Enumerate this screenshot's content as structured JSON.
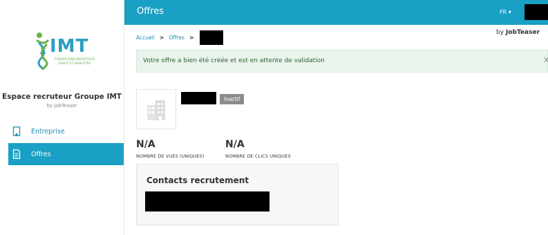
{
  "sidebar": {
    "logo": {
      "text": "IMT",
      "tagline": "FORMATIONS INDUSTRIES SANTÉ ET BIEN-ÊTRE"
    },
    "space_title": "Espace recruteur Groupe IMT",
    "space_subtitle": "by JobTeaser",
    "items": [
      {
        "label": "Entreprise",
        "icon": "building-icon",
        "active": false
      },
      {
        "label": "Offres",
        "icon": "document-icon",
        "active": true
      }
    ]
  },
  "header": {
    "title": "Offres",
    "language": "FR ▾"
  },
  "breadcrumb": {
    "home": "Accueil",
    "section": "Offres",
    "separator": ">"
  },
  "brand": {
    "prefix": "by ",
    "name": "JobTeaser"
  },
  "alert": {
    "message": "Votre offre a bien été créée et est en attente de validation",
    "close": "X"
  },
  "offer": {
    "status": "Inactif",
    "stats": [
      {
        "value": "N/A",
        "label": "NOMBRE DE VUES (UNIQUES)"
      },
      {
        "value": "N/A",
        "label": "NOMBRE DE CLICS UNIQUES"
      }
    ]
  },
  "contacts": {
    "title": "Contacts recrutement"
  },
  "colors": {
    "accent": "#1aa0c4",
    "alert_bg": "#eaf4ec",
    "badge": "#8b8b8b"
  }
}
